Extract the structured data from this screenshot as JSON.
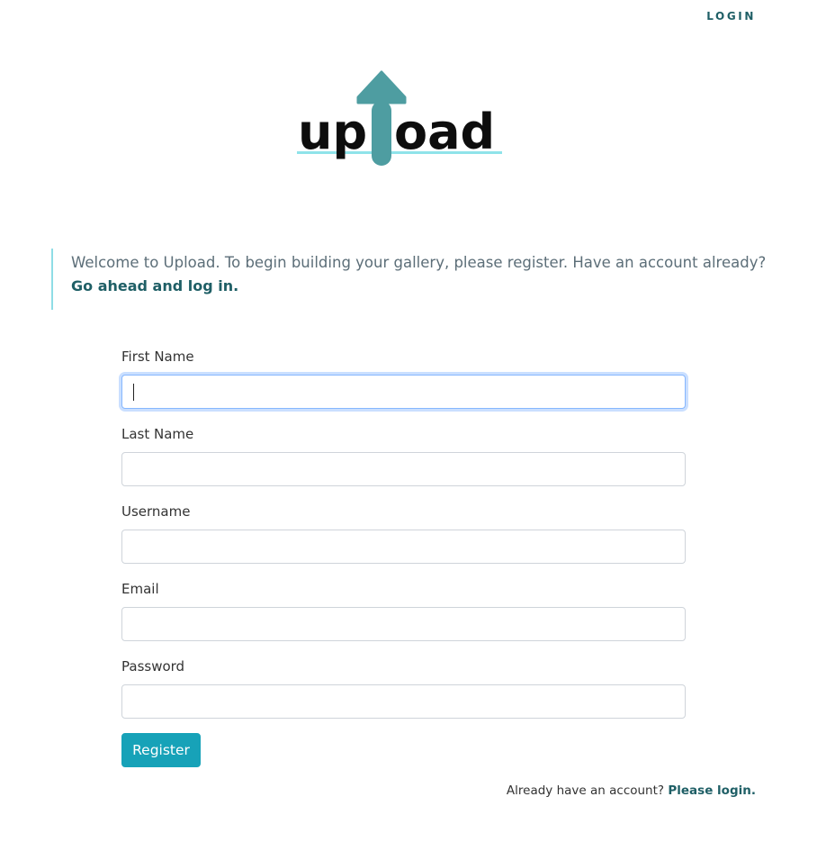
{
  "nav": {
    "login": "LOGIN"
  },
  "logo": {
    "text_left": "up",
    "text_right": "oad",
    "colors": {
      "arrow": "#4e9da1",
      "text": "#0d0d0d",
      "underline": "#8fe3ea"
    }
  },
  "welcome": {
    "text": "Welcome to Upload. To begin building your gallery, please register. Have an account already?",
    "link": "Go ahead and log in."
  },
  "form": {
    "fields": [
      {
        "label": "First Name",
        "value": ""
      },
      {
        "label": "Last Name",
        "value": ""
      },
      {
        "label": "Username",
        "value": ""
      },
      {
        "label": "Email",
        "value": ""
      },
      {
        "label": "Password",
        "value": ""
      }
    ],
    "submit": "Register"
  },
  "footer": {
    "text": "Already have an account?",
    "link": "Please login."
  },
  "colors": {
    "accent": "#17a2b8",
    "link": "#1f5f66",
    "focus": "#86b7fe"
  }
}
